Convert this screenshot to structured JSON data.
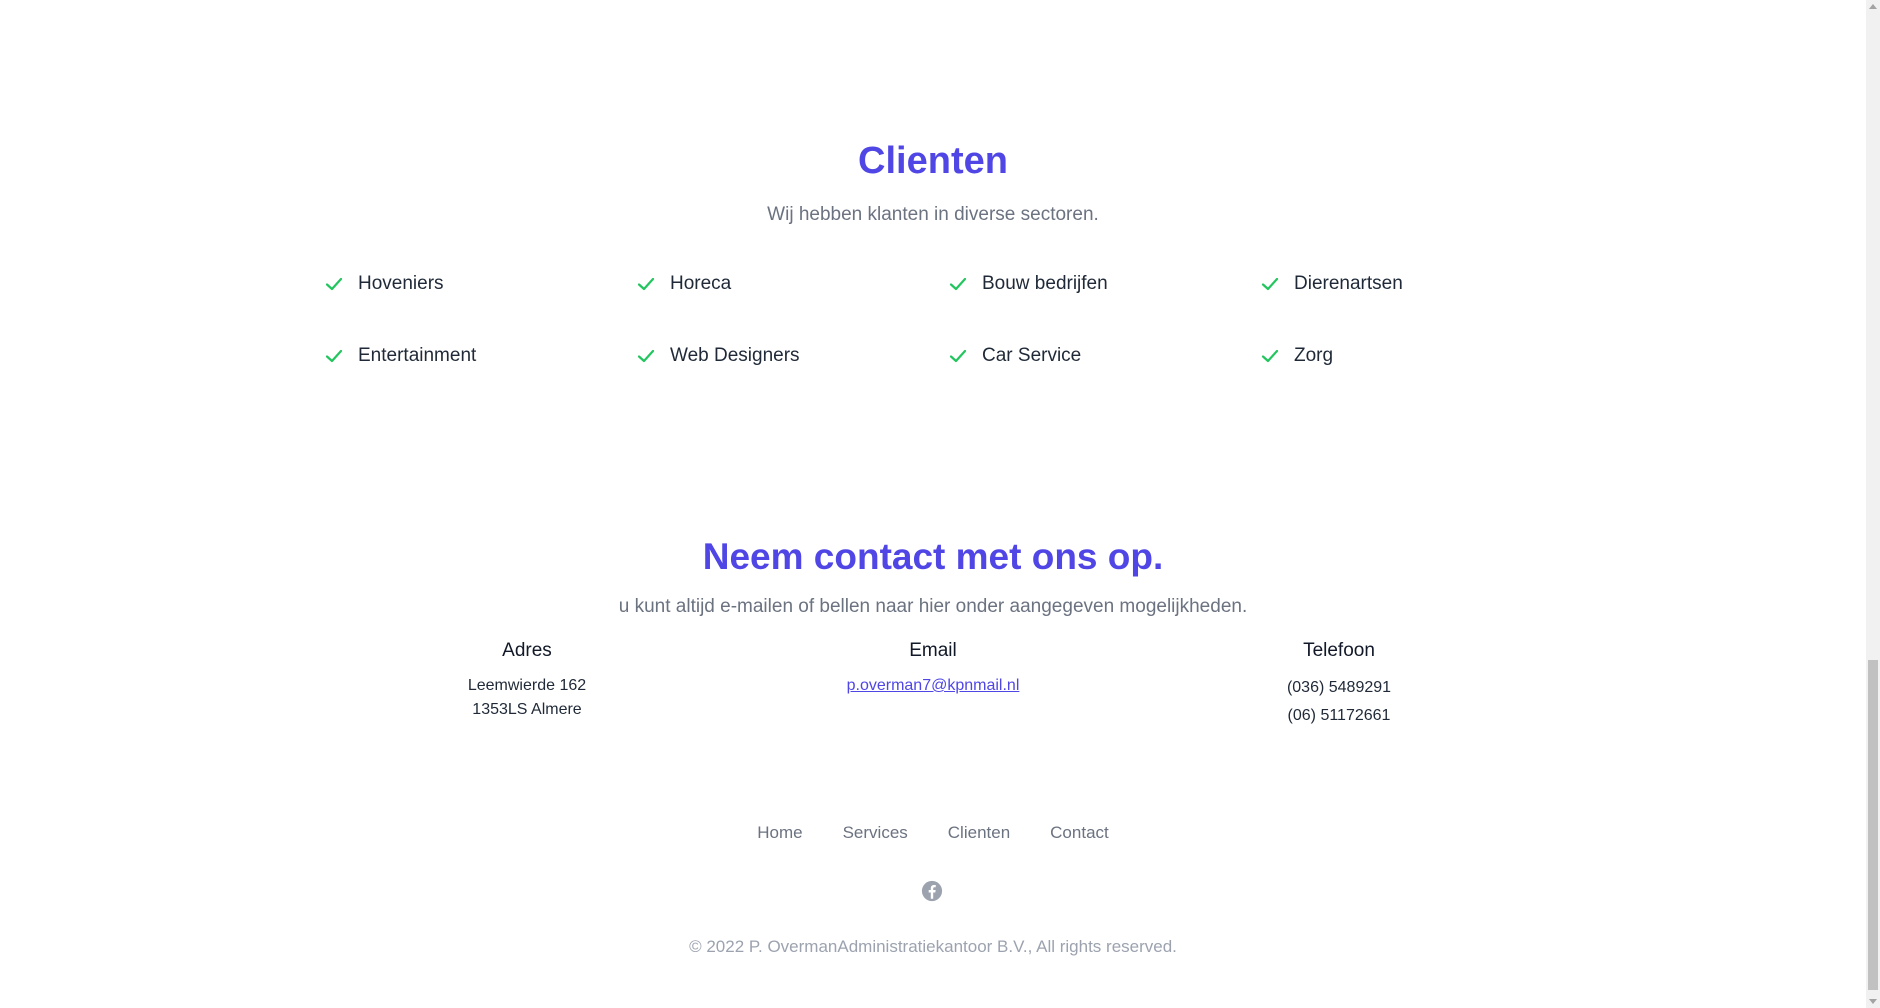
{
  "clients": {
    "title": "Clienten",
    "subtitle": "Wij hebben klanten in diverse sectoren.",
    "items": [
      "Hoveniers",
      "Horeca",
      "Bouw bedrijfen",
      "Dierenartsen",
      "Entertainment",
      "Web Designers",
      "Car Service",
      "Zorg"
    ],
    "check_icon": "check-icon",
    "check_color": "#22c55e"
  },
  "contact": {
    "title": "Neem contact met ons op.",
    "subtitle": "u kunt altijd e-mailen of bellen naar hier onder aangegeven mogelijkheden.",
    "adres": {
      "heading": "Adres",
      "line1": "Leemwierde 162",
      "line2": "1353LS Almere"
    },
    "email": {
      "heading": "Email",
      "address": "p.overman7@kpnmail.nl"
    },
    "telefoon": {
      "heading": "Telefoon",
      "phone1": "(036) 5489291",
      "phone2": "(06) 51172661"
    }
  },
  "footer": {
    "nav": [
      "Home",
      "Services",
      "Clienten",
      "Contact"
    ],
    "social_icon": "facebook-icon",
    "copyright": "© 2022 P. OvermanAdministratiekantoor B.V., All rights reserved."
  },
  "colors": {
    "accent": "#4f46e5",
    "muted": "#6b7280"
  }
}
